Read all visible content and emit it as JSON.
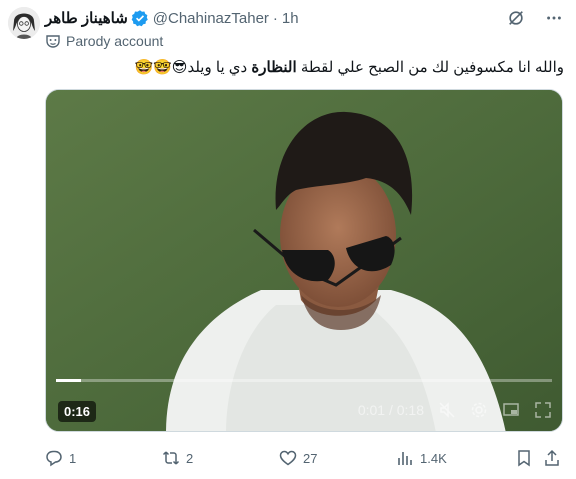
{
  "author": {
    "name": "شاهيناز طاهر",
    "handle": "@ChahinazTaher",
    "separator": "·",
    "time": "1h",
    "label": "Parody account"
  },
  "tweet": {
    "text_before": "والله انا مكسوفين لك من الصبح علي لقطة",
    "text_bold": "النظارة",
    "text_after": "دي  يا ويلد",
    "emojis": "😎🤓🤓"
  },
  "video": {
    "badge": "0:16",
    "clock": "0:01 / 0:18",
    "progress": 0.05
  },
  "actions": {
    "replies": "1",
    "retweets": "2",
    "likes": "27",
    "views": "1.4K"
  },
  "colors": {
    "text": "#0f1419",
    "muted": "#536471",
    "verified": "#1d9bf0",
    "field": "#4f6b3e"
  }
}
